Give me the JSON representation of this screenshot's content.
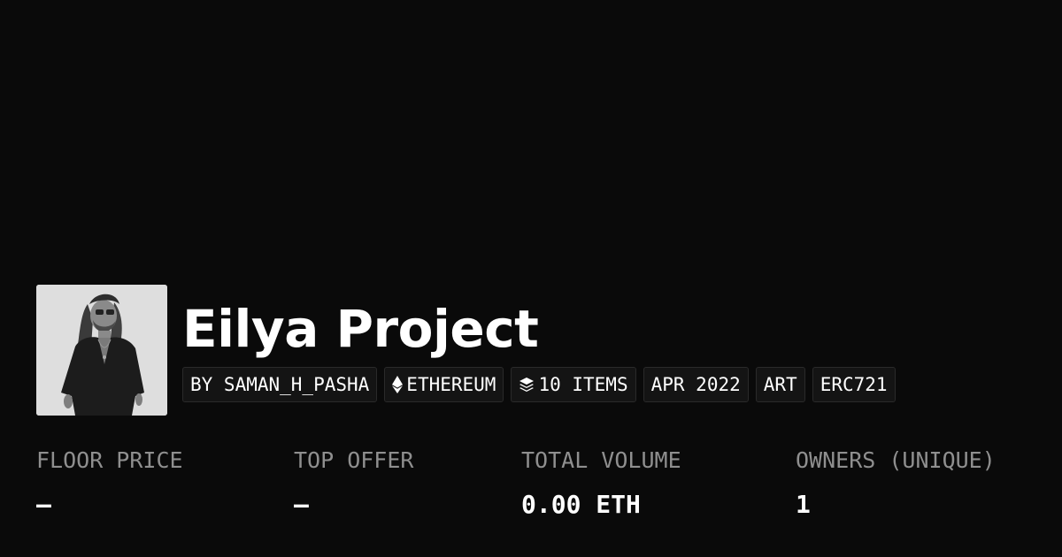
{
  "collection": {
    "title": "Eilya Project",
    "tags": [
      {
        "label": "BY SAMAN_H_PASHA",
        "icon": null
      },
      {
        "label": "ETHEREUM",
        "icon": "ethereum-icon"
      },
      {
        "label": "10 ITEMS",
        "icon": "layers-icon"
      },
      {
        "label": "APR 2022",
        "icon": null
      },
      {
        "label": "ART",
        "icon": null
      },
      {
        "label": "ERC721",
        "icon": null
      }
    ]
  },
  "stats": [
    {
      "label": "FLOOR PRICE",
      "value": "–"
    },
    {
      "label": "TOP OFFER",
      "value": "–"
    },
    {
      "label": "TOTAL VOLUME",
      "value": "0.00 ETH"
    },
    {
      "label": "OWNERS (UNIQUE)",
      "value": "1"
    }
  ],
  "colors": {
    "background": "#0a0a0a",
    "tag_background": "#141414",
    "label_gray": "#8f8f8f"
  }
}
